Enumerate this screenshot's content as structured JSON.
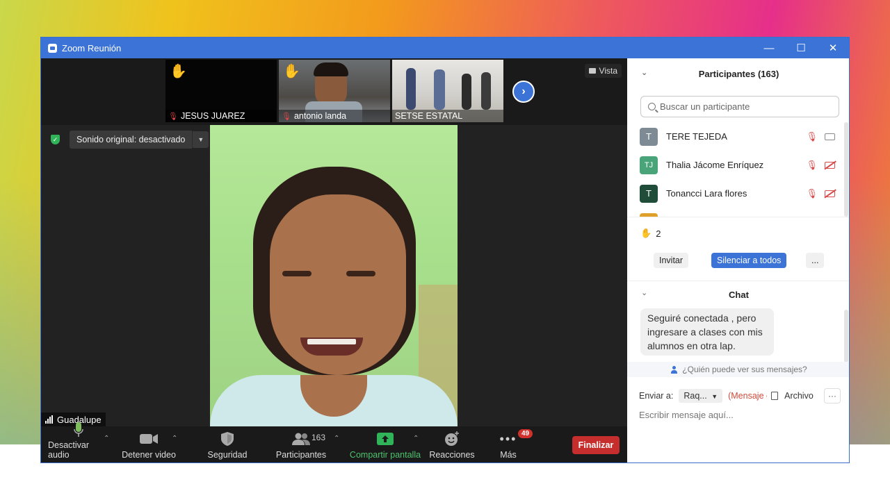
{
  "window": {
    "title": "Zoom Reunión"
  },
  "thumbnails": [
    {
      "name": "JESUS JUAREZ",
      "muted": true,
      "hand_raised": true
    },
    {
      "name": "antonio landa",
      "muted": true,
      "hand_raised": true
    },
    {
      "name": "SETSE ESTATAL",
      "muted": false,
      "hand_raised": false
    }
  ],
  "view_button": "Vista",
  "sound": {
    "label": "Sonido original: desactivado"
  },
  "speaker": {
    "name": "Guadalupe"
  },
  "toolbar": {
    "audio": "Desactivar audio",
    "video": "Detener video",
    "security": "Seguridad",
    "participants": "Participantes",
    "participants_count": "163",
    "share": "Compartir pantalla",
    "reactions": "Reacciones",
    "more": "Más",
    "more_badge": "49",
    "end": "Finalizar"
  },
  "panel": {
    "participants_title": "Participantes (163)",
    "search_placeholder": "Buscar un participante",
    "participants": [
      {
        "initials": "T",
        "name": "TERE TEJEDA",
        "color": "#7e8a94",
        "video_off": false
      },
      {
        "initials": "TJ",
        "name": "Thalia Jácome Enríquez",
        "color": "#4aa47a",
        "video_off": true
      },
      {
        "initials": "T",
        "name": "Tonancci Lara flores",
        "color": "#1f4d3a",
        "video_off": true
      }
    ],
    "hands_count": "2",
    "invite": "Invitar",
    "mute_all": "Silenciar a todos",
    "more": "...",
    "chat_title": "Chat",
    "chat_message": "Seguiré conectada , pero ingresare a clases con mis alumnos en otra lap.",
    "who_can_see": "¿Quién puede ver sus mensajes?",
    "send_to_label": "Enviar a:",
    "send_to_value": "Raq...",
    "private_label": "(Mensaje c",
    "file_label": "Archivo",
    "input_placeholder": "Escribir mensaje aquí..."
  },
  "colors": {
    "accent": "#3b73d6",
    "end_button": "#c62d2d",
    "share_green": "#31b35a"
  }
}
